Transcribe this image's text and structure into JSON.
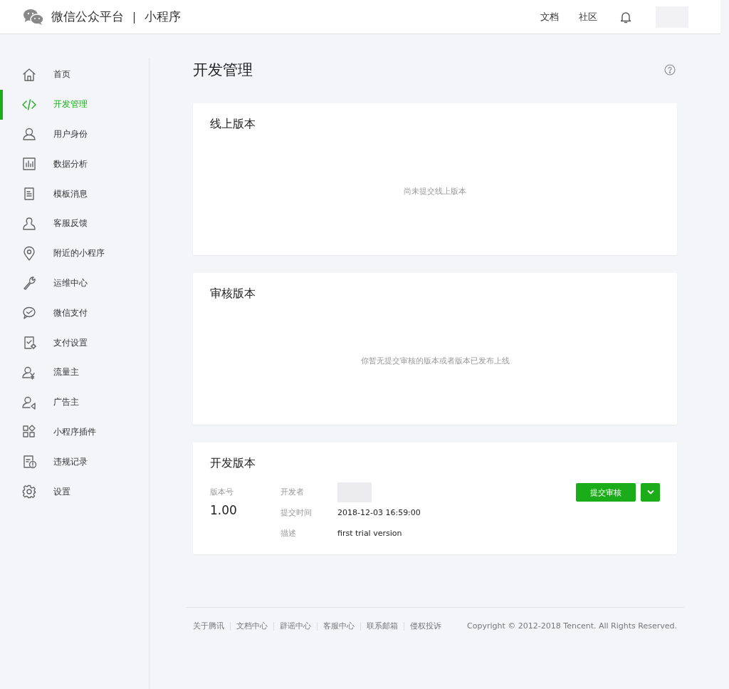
{
  "header": {
    "brand": "微信公众平台",
    "separator": "|",
    "product": "小程序",
    "links": [
      "文档",
      "社区"
    ]
  },
  "sidebar": {
    "items": [
      {
        "label": "首页",
        "selected": false
      },
      {
        "label": "开发管理",
        "selected": true
      },
      {
        "label": "用户身份",
        "selected": false
      },
      {
        "label": "数据分析",
        "selected": false
      },
      {
        "label": "模板消息",
        "selected": false
      },
      {
        "label": "客服反馈",
        "selected": false
      },
      {
        "label": "附近的小程序",
        "selected": false
      },
      {
        "label": "运维中心",
        "selected": false
      },
      {
        "label": "微信支付",
        "selected": false
      },
      {
        "label": "支付设置",
        "selected": false
      },
      {
        "label": "流量主",
        "selected": false
      },
      {
        "label": "广告主",
        "selected": false
      },
      {
        "label": "小程序插件",
        "selected": false
      },
      {
        "label": "违规记录",
        "selected": false
      },
      {
        "label": "设置",
        "selected": false
      }
    ]
  },
  "page_title": "开发管理",
  "sections": [
    {
      "kind": "empty",
      "title": "线上版本",
      "message": "尚未提交线上版本"
    },
    {
      "kind": "empty",
      "title": "审核版本",
      "message": "你暂无提交审核的版本或者版本已发布上线"
    },
    {
      "kind": "version",
      "title": "开发版本",
      "version_label": "版本号",
      "version": "1.00",
      "fields": [
        {
          "label": "开发者"
        },
        {
          "label": "提交时间",
          "value": "2018-12-03 16:59:00"
        },
        {
          "label": "描述",
          "value": "first trial version"
        }
      ],
      "submit_button": "提交审核"
    }
  ],
  "footer": {
    "links": [
      "关于腾讯",
      "文档中心",
      "辟谣中心",
      "客服中心",
      "联系邮箱",
      "侵权投诉"
    ],
    "copyright": "Copyright © 2012-2018 Tencent. All Rights Reserved."
  }
}
